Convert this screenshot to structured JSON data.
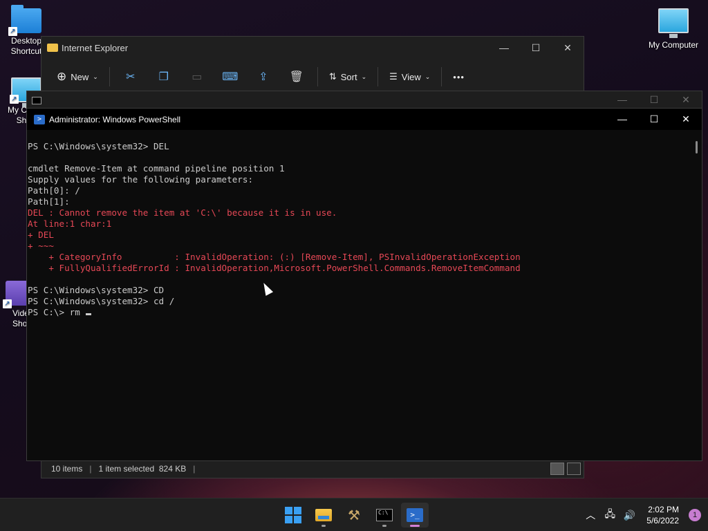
{
  "desktop": {
    "icons": [
      {
        "label": "Desktop Shortcut",
        "icon": "folder-icon"
      },
      {
        "label": "My Co… - Short",
        "icon": "monitor-icon"
      },
      {
        "label": "Vide… Shor",
        "icon": "video-icon"
      },
      {
        "label": "My Computer",
        "icon": "monitor-icon"
      }
    ]
  },
  "explorer": {
    "title": "Internet Explorer",
    "toolbar": {
      "new_label": "New",
      "sort_label": "Sort",
      "view_label": "View",
      "more_label": "•••"
    },
    "status": {
      "items_count": "10 items",
      "selection": "1 item selected  824 KB",
      "separator": "|"
    }
  },
  "powershell": {
    "title": "Administrator: Windows PowerShell",
    "lines": [
      {
        "text": "PS C:\\Windows\\system32> DEL",
        "type": "normal"
      },
      {
        "text": "",
        "type": "blank"
      },
      {
        "text": "cmdlet Remove-Item at command pipeline position 1",
        "type": "normal"
      },
      {
        "text": "Supply values for the following parameters:",
        "type": "normal"
      },
      {
        "text": "Path[0]: /",
        "type": "normal"
      },
      {
        "text": "Path[1]:",
        "type": "normal"
      },
      {
        "text": "DEL : Cannot remove the item at 'C:\\' because it is in use.",
        "type": "error"
      },
      {
        "text": "At line:1 char:1",
        "type": "error"
      },
      {
        "text": "+ DEL",
        "type": "error"
      },
      {
        "text": "+ ~~~",
        "type": "error"
      },
      {
        "text": "    + CategoryInfo          : InvalidOperation: (:) [Remove-Item], PSInvalidOperationException",
        "type": "error"
      },
      {
        "text": "    + FullyQualifiedErrorId : InvalidOperation,Microsoft.PowerShell.Commands.RemoveItemCommand",
        "type": "error"
      },
      {
        "text": "",
        "type": "blank"
      },
      {
        "text": "PS C:\\Windows\\system32> CD",
        "type": "normal"
      },
      {
        "text": "PS C:\\Windows\\system32> cd /",
        "type": "normal"
      },
      {
        "text": "PS C:\\> rm ",
        "type": "prompt"
      }
    ]
  },
  "taskbar": {
    "apps": [
      "start-icon",
      "file-explorer-icon",
      "tools-icon",
      "command-prompt-icon",
      "powershell-icon"
    ],
    "clock_time": "2:02 PM",
    "clock_date": "5/6/2022",
    "notification_count": "1"
  },
  "colors": {
    "error": "#e74856",
    "console_text": "#cccccc",
    "accent": "#3aa0f3"
  }
}
